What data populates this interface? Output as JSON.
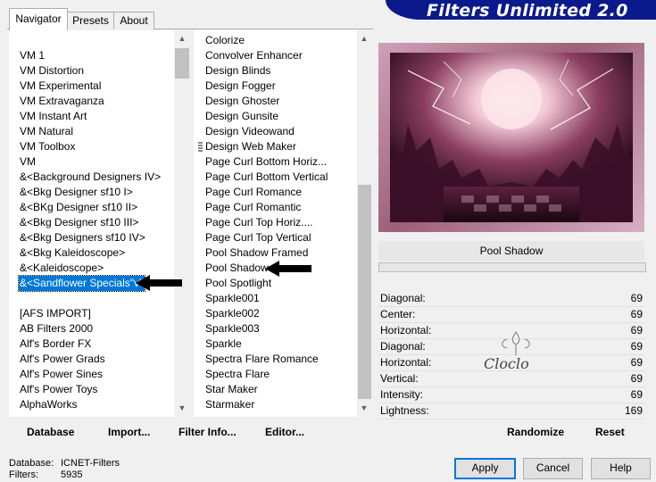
{
  "tabs": [
    {
      "label": "Navigator",
      "active": true
    },
    {
      "label": "Presets",
      "active": false
    },
    {
      "label": "About",
      "active": false
    }
  ],
  "banner": {
    "title": "Filters Unlimited 2.0",
    "color": "#0a1a8c"
  },
  "categories": [
    "VM 1",
    "VM Distortion",
    "VM Experimental",
    "VM Extravaganza",
    "VM Instant Art",
    "VM Natural",
    "VM Toolbox",
    "VM",
    "&<Background Designers IV>",
    "&<Bkg Designer sf10 I>",
    "&<BKg Designer sf10 II>",
    "&<Bkg Designer sf10 III>",
    "&<Bkg Designers sf10 IV>",
    "&<Bkg Kaleidoscope>",
    "&<Kaleidoscope>",
    "&<Sandflower Specials\"v\">",
    "",
    "[AFS IMPORT]",
    "AB Filters 2000",
    "Alf's Border FX",
    "Alf's Power Grads",
    "Alf's Power Sines",
    "Alf's Power Toys",
    "AlphaWorks"
  ],
  "selected_category": "&<Sandflower Specials\"v\">",
  "filters": [
    "Colorize",
    "Convolver Enhancer",
    "Design Blinds",
    "Design Fogger",
    "Design Ghoster",
    "Design Gunsite",
    "Design Videowand",
    "Design Web Maker",
    "Page Curl Bottom Horiz...",
    "Page Curl Bottom Vertical",
    "Page Curl Romance",
    "Page Curl Romantic",
    "Page Curl Top Horiz....",
    "Page Curl Top Vertical",
    "Pool Shadow Framed",
    "Pool Shadow",
    "Pool Spotlight",
    "Sparkle001",
    "Sparkle002",
    "Sparkle003",
    "Sparkle",
    "Spectra Flare Romance",
    "Spectra Flare",
    "Star Maker",
    "Starmaker"
  ],
  "filter_name": "Pool Shadow",
  "params": [
    {
      "label": "Diagonal:",
      "value": "69"
    },
    {
      "label": "Center:",
      "value": "69"
    },
    {
      "label": "Horizontal:",
      "value": "69"
    },
    {
      "label": "Diagonal:",
      "value": "69"
    },
    {
      "label": "Horizontal:",
      "value": "69"
    },
    {
      "label": "Vertical:",
      "value": "69"
    },
    {
      "label": "Intensity:",
      "value": "69"
    },
    {
      "label": "Lightness:",
      "value": "169"
    }
  ],
  "watermark": "Cloclo",
  "commands": {
    "database": "Database",
    "import": "Import...",
    "filter_info": "Filter Info...",
    "editor": "Editor...",
    "randomize": "Randomize",
    "reset": "Reset"
  },
  "buttons": {
    "apply": "Apply",
    "cancel": "Cancel",
    "help": "Help"
  },
  "status": {
    "database_label": "Database:",
    "database_value": "ICNET-Filters",
    "filters_label": "Filters:",
    "filters_value": "5935"
  },
  "colors": {
    "selection": "#0078d7",
    "accent": "#0078d7"
  }
}
